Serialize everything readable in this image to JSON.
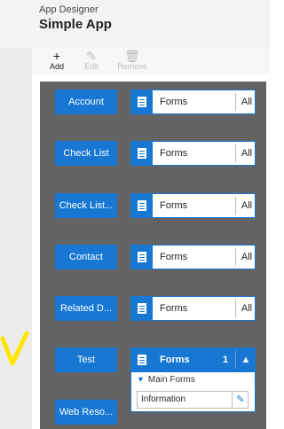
{
  "header": {
    "subtitle": "App Designer",
    "title": "Simple App"
  },
  "toolbar": {
    "add": {
      "label": "Add",
      "icon": "plus-icon"
    },
    "edit": {
      "label": "Edit",
      "icon": "pencil-icon"
    },
    "remove": {
      "label": "Remove",
      "icon": "trash-icon"
    }
  },
  "entities": [
    {
      "name": "Account",
      "forms_label": "Forms",
      "count": "All"
    },
    {
      "name": "Check List",
      "forms_label": "Forms",
      "count": "All"
    },
    {
      "name": "Check List...",
      "forms_label": "Forms",
      "count": "All"
    },
    {
      "name": "Contact",
      "forms_label": "Forms",
      "count": "All"
    },
    {
      "name": "Related D...",
      "forms_label": "Forms",
      "count": "All"
    },
    {
      "name": "Test",
      "forms_label": "Forms",
      "count": "1"
    },
    {
      "name": "Web Reso..."
    }
  ],
  "dropdown": {
    "section": "Main Forms",
    "item": "Information"
  },
  "colors": {
    "accent": "#1777d3",
    "canvas": "#636363",
    "annotation": "#ffe600"
  }
}
